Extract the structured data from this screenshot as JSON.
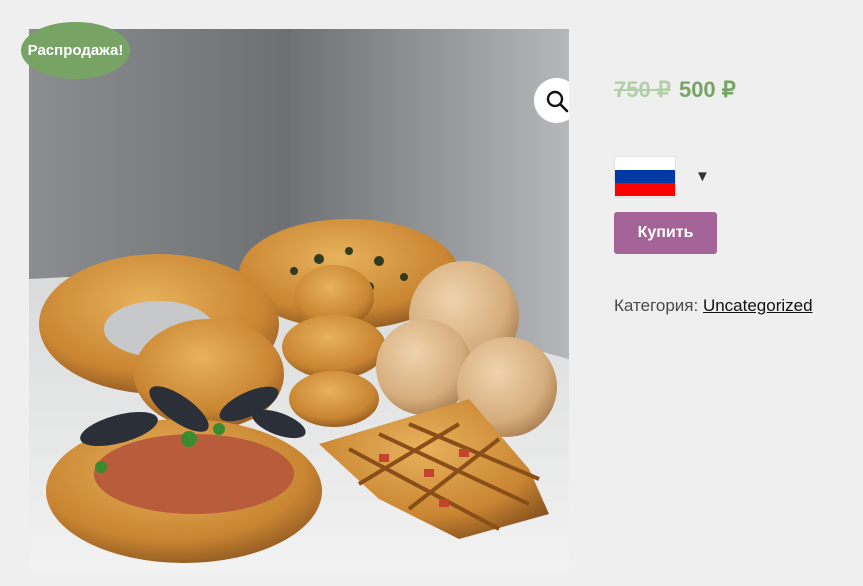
{
  "product": {
    "sale_badge": "Распродажа!",
    "price_old": "750 ₽",
    "price_new": "500 ₽",
    "buy_label": "Купить",
    "category_label": "Категория:",
    "category_link": "Uncategorized",
    "language_flag": "russia-flag-icon",
    "zoom_icon": "magnifier-icon",
    "image_subject": "product-photo-pastries"
  },
  "colors": {
    "background": "#efefef",
    "sale_green": "#77a464",
    "button_purple": "#a46497",
    "flag_white": "#ffffff",
    "flag_blue": "#0039a6",
    "flag_red": "#ff0000"
  }
}
